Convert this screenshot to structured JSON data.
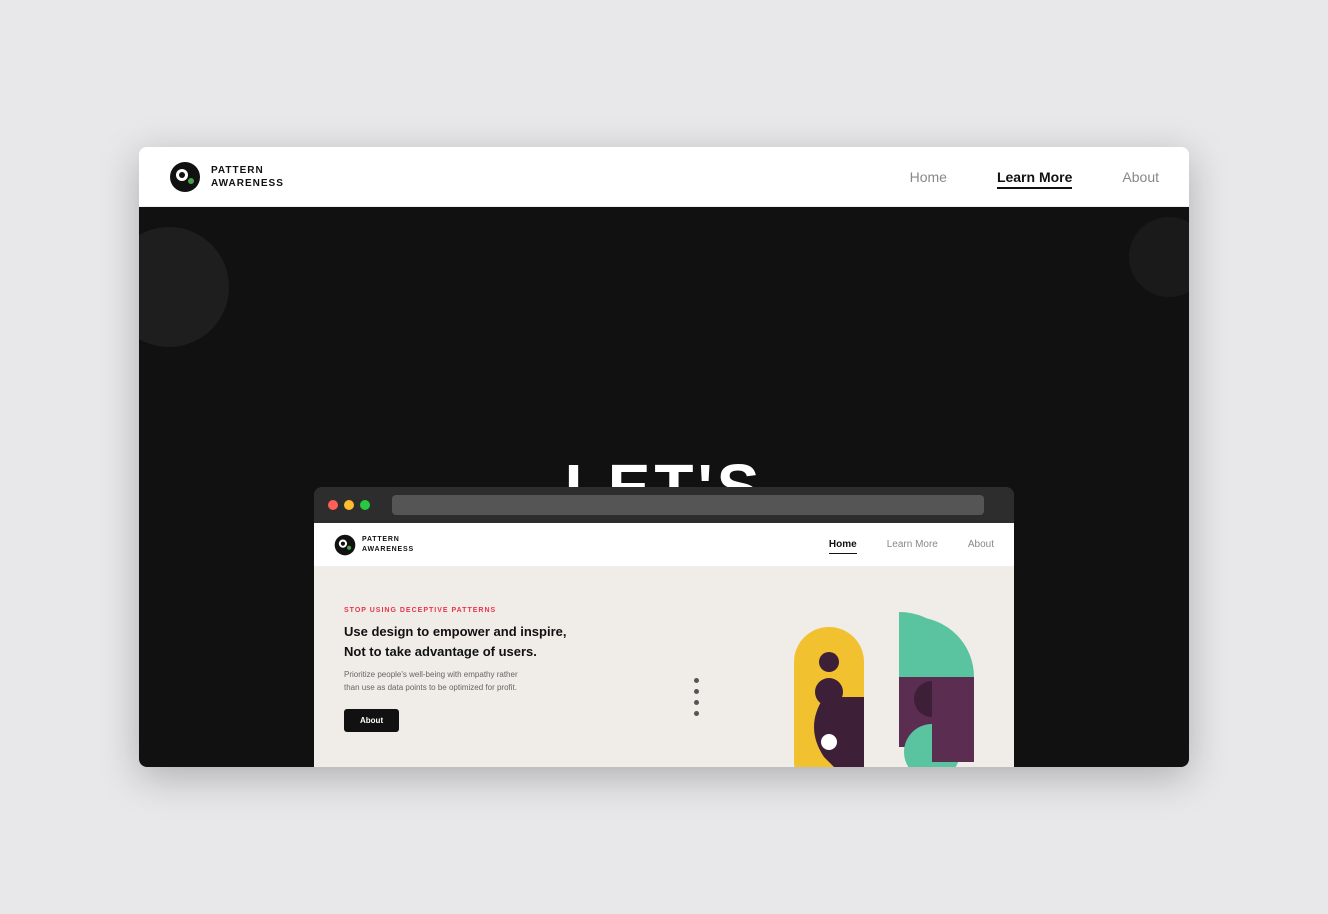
{
  "page": {
    "background_color": "#e8e8ea"
  },
  "top_nav": {
    "logo_text_line1": "PATTERN",
    "logo_text_line2": "AWARENESS",
    "links": [
      {
        "id": "home",
        "label": "Home",
        "active": false
      },
      {
        "id": "learn-more",
        "label": "Learn More",
        "active": true
      },
      {
        "id": "about",
        "label": "About",
        "active": false
      }
    ]
  },
  "hero": {
    "title": "LET'S"
  },
  "browser": {
    "dots": [
      "red",
      "yellow",
      "green"
    ]
  },
  "inner_nav": {
    "logo_text_line1": "PATTERN",
    "logo_text_line2": "AWARENESS",
    "links": [
      {
        "id": "home",
        "label": "Home",
        "active": true
      },
      {
        "id": "learn-more",
        "label": "Learn More",
        "active": false
      },
      {
        "id": "about",
        "label": "About",
        "active": false
      }
    ]
  },
  "inner_hero": {
    "tag": "STOP USING DECEPTIVE PATTERNS",
    "title_line1": "Use design to empower and inspire,",
    "title_line2": "Not to take advantage of users.",
    "description": "Prioritize people's well-being with empathy rather than use as data points to be optimized for profit.",
    "button_label": "About"
  },
  "colors": {
    "yellow": "#f2c130",
    "teal": "#5ac4a0",
    "purple": "#5a2d51",
    "red": "#e8344a"
  }
}
